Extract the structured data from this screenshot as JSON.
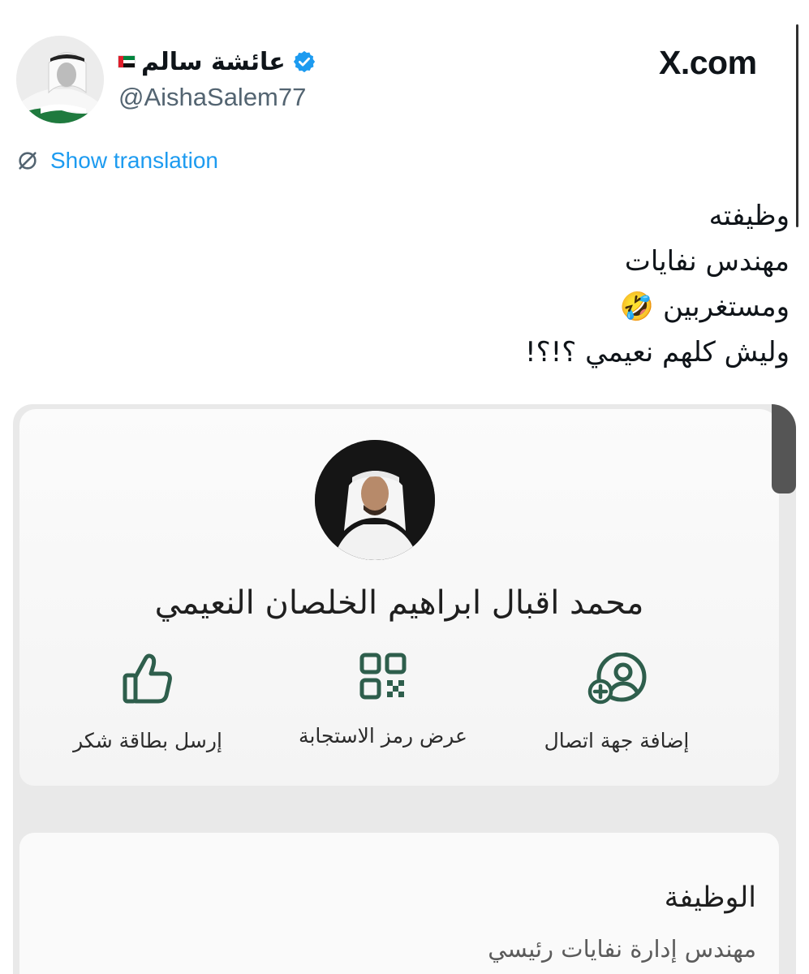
{
  "tweet": {
    "author": {
      "display_name": "عائشة سالم",
      "handle": "@AishaSalem77",
      "verified": true,
      "flag": "UAE flag"
    },
    "site": "X.com",
    "show_translation": "Show translation",
    "text_lines": [
      "وظيفته",
      "مهندس نفايات",
      "ومستغربين 🤣",
      "وليش كلهم نعيمي ؟!؟!"
    ]
  },
  "card": {
    "person_name": "محمد اقبال ابراهيم الخلصان النعيمي",
    "actions": [
      {
        "label": "إضافة جهة اتصال",
        "icon": "add-contact-icon"
      },
      {
        "label": "عرض رمز الاستجابة",
        "icon": "qr-code-icon"
      },
      {
        "label": "إرسل بطاقة شكر",
        "icon": "thumbs-up-icon"
      }
    ],
    "job": {
      "label": "الوظيفة",
      "value": "مهندس إدارة نفايات رئيسي"
    }
  },
  "colors": {
    "link": "#1d9bf0",
    "verified": "#1d9bf0",
    "card_icon": "#2e5e4c",
    "handle": "#536471"
  }
}
